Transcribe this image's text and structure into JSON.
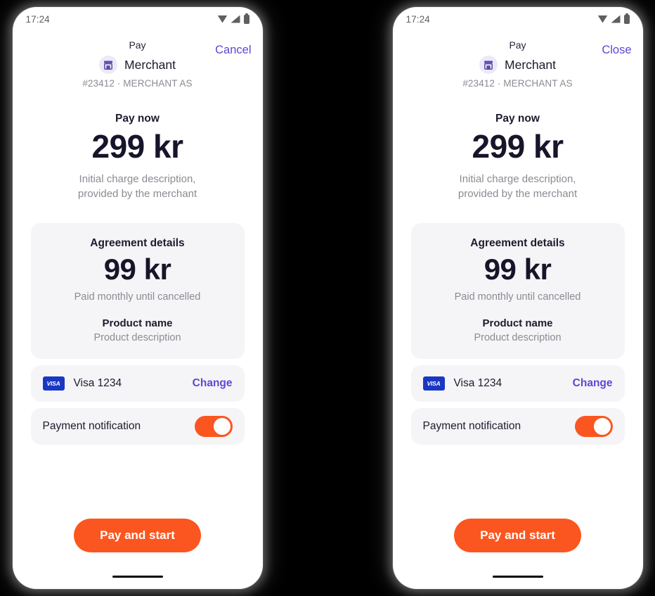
{
  "screens": [
    {
      "id": "screen-cancel",
      "status_bar": {
        "time": "17:24",
        "icons": [
          "wifi-icon",
          "signal-icon",
          "battery-icon"
        ]
      },
      "nav": {
        "title": "Pay",
        "action_label": "Cancel"
      },
      "merchant": {
        "icon": "storefront-icon",
        "name": "Merchant",
        "subtitle": "#23412 · MERCHANT AS"
      },
      "amount": {
        "label": "Pay now",
        "value": "299 kr",
        "description_line1": "Initial charge description,",
        "description_line2": "provided by the merchant"
      },
      "agreement": {
        "title": "Agreement details",
        "amount": "99 kr",
        "cadence": "Paid monthly until cancelled",
        "product_name": "Product name",
        "product_description": "Product description"
      },
      "payment_method": {
        "brand_icon": "visa-icon",
        "brand_text": "VISA",
        "label": "Visa 1234",
        "change_label": "Change"
      },
      "notification": {
        "label": "Payment notification",
        "enabled": true
      },
      "cta": {
        "label": "Pay and start"
      }
    },
    {
      "id": "screen-close",
      "status_bar": {
        "time": "17:24",
        "icons": [
          "wifi-icon",
          "signal-icon",
          "battery-icon"
        ]
      },
      "nav": {
        "title": "Pay",
        "action_label": "Close"
      },
      "merchant": {
        "icon": "storefront-icon",
        "name": "Merchant",
        "subtitle": "#23412 · MERCHANT AS"
      },
      "amount": {
        "label": "Pay now",
        "value": "299 kr",
        "description_line1": "Initial charge description,",
        "description_line2": "provided by the merchant"
      },
      "agreement": {
        "title": "Agreement details",
        "amount": "99 kr",
        "cadence": "Paid monthly until cancelled",
        "product_name": "Product name",
        "product_description": "Product description"
      },
      "payment_method": {
        "brand_icon": "visa-icon",
        "brand_text": "VISA",
        "label": "Visa 1234",
        "change_label": "Change"
      },
      "notification": {
        "label": "Payment notification",
        "enabled": true
      },
      "cta": {
        "label": "Pay and start"
      }
    }
  ],
  "colors": {
    "background": "#000000",
    "accent_orange": "#FB5620",
    "link_purple": "#5F46D6",
    "text_dark": "#1D1B2E",
    "text_muted": "#8B8B93",
    "card_surface": "#F5F5F7",
    "visa_blue": "#1A37C4",
    "merchant_badge_bg": "#ECE9F8"
  }
}
